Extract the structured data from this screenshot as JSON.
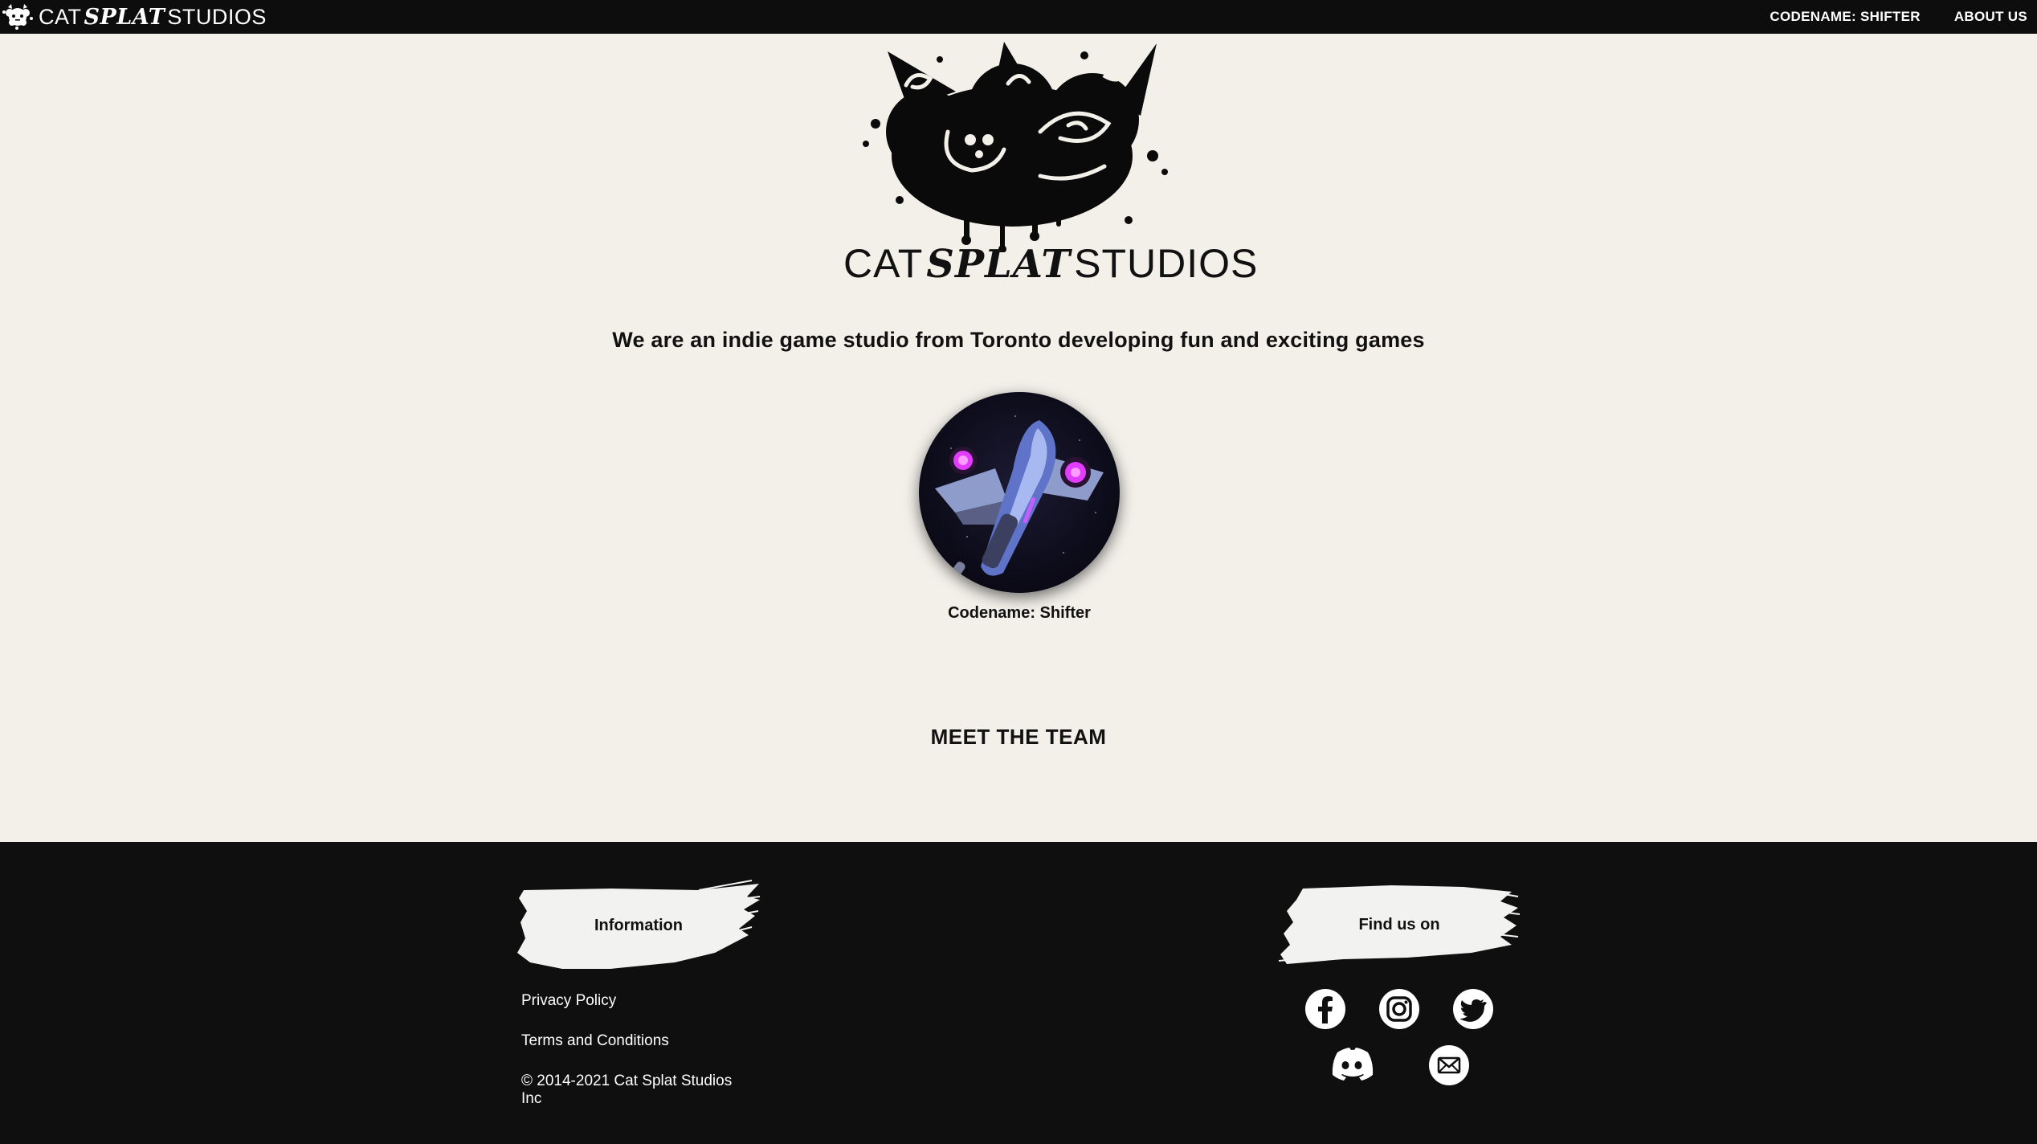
{
  "nav": {
    "brand_cat": "CAT",
    "brand_splat": "SPLAT",
    "brand_studios": "STUDIOS",
    "links": [
      "CODENAME: SHIFTER",
      "ABOUT US"
    ]
  },
  "hero": {
    "logo_cat": "CAT",
    "logo_splat": "SPLAT",
    "logo_studios": "STUDIOS",
    "tagline": "We are an indie game studio from Toronto developing fun and exciting games"
  },
  "games": [
    {
      "caption": "Codename: Shifter",
      "image_icon": "spaceship-image"
    }
  ],
  "team": {
    "heading": "MEET THE TEAM"
  },
  "footer": {
    "info_heading": "Information",
    "links": [
      "Privacy Policy",
      "Terms and Conditions"
    ],
    "copyright": "© 2014-2021 Cat Splat Studios Inc",
    "find_heading": "Find us on",
    "social": [
      "facebook-icon",
      "instagram-icon",
      "twitter-icon",
      "discord-icon",
      "email-icon"
    ]
  },
  "colors": {
    "page_bg": "#f3f0ea",
    "nav_bg": "#0d0d0d",
    "footer_bg": "#0f0f0f",
    "brush": "#f2f2f0",
    "accent_magenta": "#e13cff"
  }
}
